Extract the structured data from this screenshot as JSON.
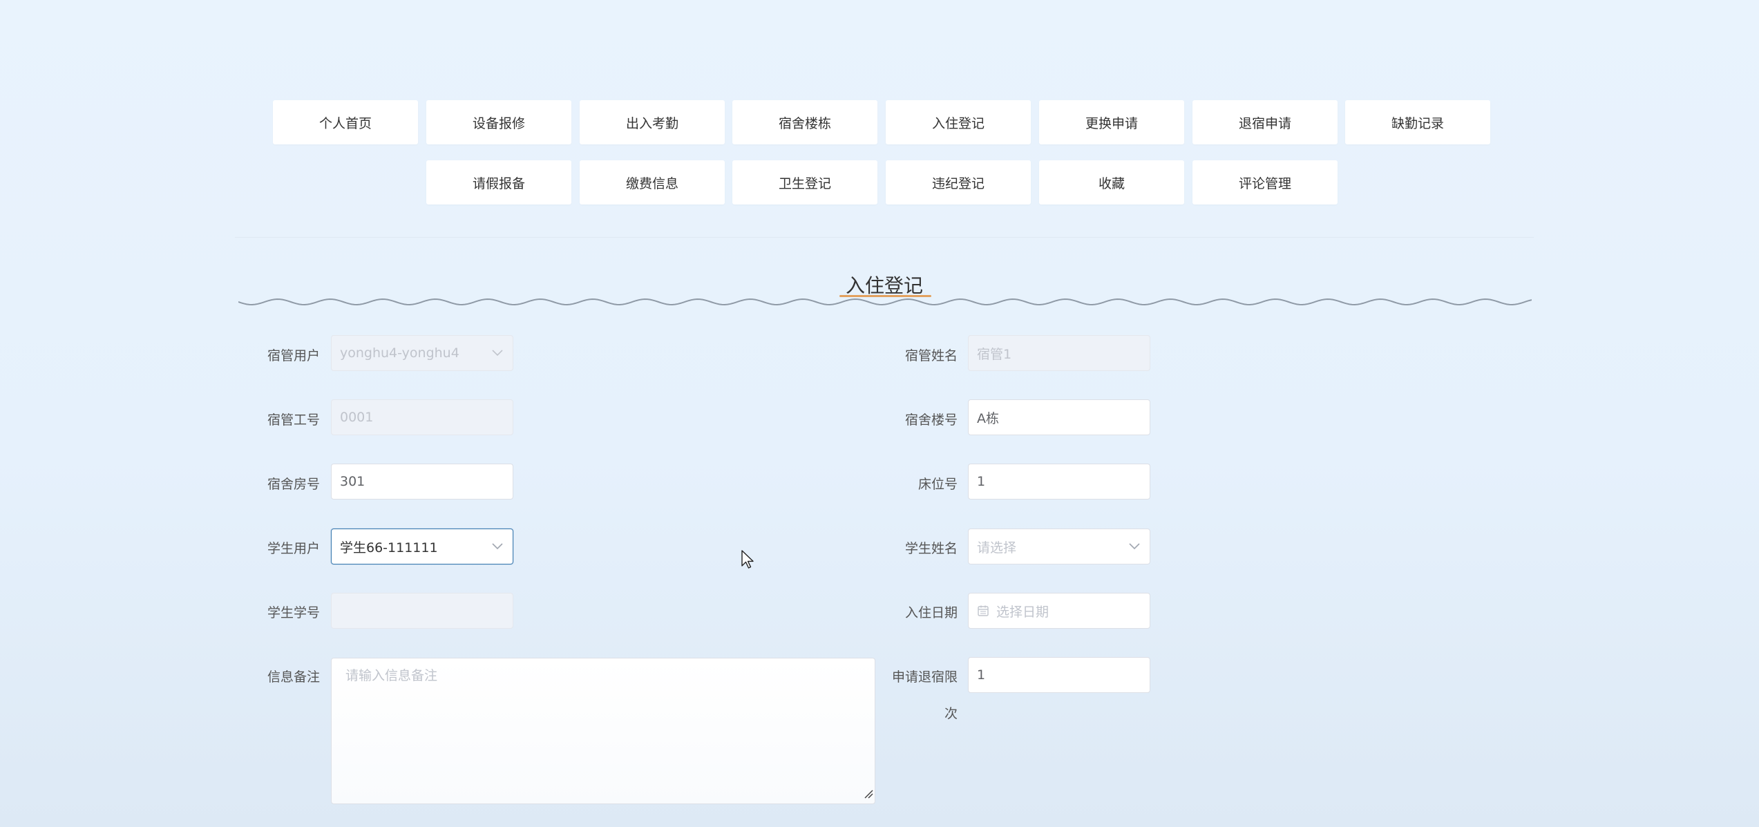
{
  "nav": {
    "row1": [
      "个人首页",
      "设备报修",
      "出入考勤",
      "宿舍楼栋",
      "入住登记",
      "更换申请",
      "退宿申请",
      "缺勤记录"
    ],
    "row2": [
      "请假报备",
      "缴费信息",
      "卫生登记",
      "违纪登记",
      "收藏",
      "评论管理"
    ]
  },
  "page": {
    "title": "入住登记"
  },
  "form": {
    "manager_user": {
      "label": "宿管用户",
      "value": "yonghu4-yonghu4"
    },
    "manager_name": {
      "label": "宿管姓名",
      "value": "宿管1"
    },
    "manager_id": {
      "label": "宿管工号",
      "value": "0001"
    },
    "building": {
      "label": "宿舍楼号",
      "value": "A栋"
    },
    "room": {
      "label": "宿舍房号",
      "value": "301"
    },
    "bed": {
      "label": "床位号",
      "value": "1"
    },
    "student_user": {
      "label": "学生用户",
      "value": "学生66-111111"
    },
    "student_name": {
      "label": "学生姓名",
      "placeholder": "请选择"
    },
    "student_no": {
      "label": "学生学号",
      "value": ""
    },
    "checkin_date": {
      "label": "入住日期",
      "placeholder": "选择日期"
    },
    "remark": {
      "label": "信息备注",
      "placeholder": "请输入信息备注"
    },
    "checkout_limit": {
      "label_line1": "申请退宿限",
      "label_line2": "次",
      "value": "1"
    }
  },
  "icons": {
    "select": "chevron-down-icon",
    "date": "calendar-icon",
    "resize": "resize-grip-icon",
    "cursor": "mouse-cursor-icon"
  },
  "colors": {
    "background": "#e8f2fc",
    "focus_border": "#3b7ab0",
    "title_underline": "#e2a15f",
    "wave": "#8f9aa6"
  }
}
